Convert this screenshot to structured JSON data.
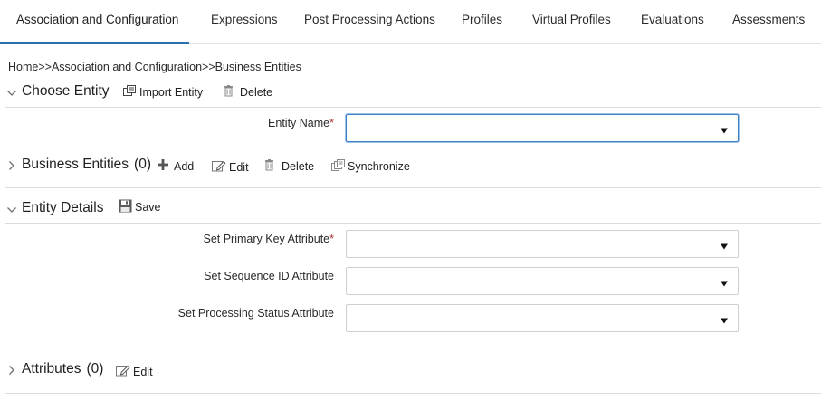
{
  "tabs": [
    {
      "label": "Association and Configuration",
      "active": true
    },
    {
      "label": "Expressions",
      "active": false
    },
    {
      "label": "Post Processing Actions",
      "active": false
    },
    {
      "label": "Profiles",
      "active": false
    },
    {
      "label": "Virtual Profiles",
      "active": false
    },
    {
      "label": "Evaluations",
      "active": false
    },
    {
      "label": "Assessments",
      "active": false
    }
  ],
  "breadcrumb": {
    "home": "Home",
    "sep1": ">>",
    "section": "Association and Configuration",
    "sep2": ">>",
    "current": "Business Entities"
  },
  "choose_entity": {
    "title": "Choose Entity",
    "import_label": "Import Entity",
    "delete_label": "Delete",
    "entity_name_label": "Entity Name",
    "entity_name_value": ""
  },
  "business_entities": {
    "title": "Business Entities",
    "count": "(0)",
    "add_label": "Add",
    "edit_label": "Edit",
    "delete_label": "Delete",
    "sync_label": "Synchronize"
  },
  "entity_details": {
    "title": "Entity Details",
    "save_label": "Save",
    "primary_key_label": "Set Primary Key Attribute",
    "primary_key_value": "",
    "sequence_id_label": "Set Sequence ID Attribute",
    "sequence_id_value": "",
    "processing_status_label": "Set Processing Status Attribute",
    "processing_status_value": ""
  },
  "attributes": {
    "title": "Attributes",
    "count": "(0)",
    "edit_label": "Edit"
  },
  "required_marker": "*",
  "colors": {
    "accent": "#2a6fb0",
    "focus_border": "#3d82c4",
    "divider": "#dcdcdc"
  },
  "icons": {
    "collapse": "chevron-down-icon",
    "expand": "chevron-right-icon",
    "import": "import-icon",
    "delete": "trash-icon",
    "add": "plus-icon",
    "edit": "edit-icon",
    "sync": "synchronize-icon",
    "save": "floppy-disk-icon",
    "dropdown": "caret-down-icon"
  }
}
